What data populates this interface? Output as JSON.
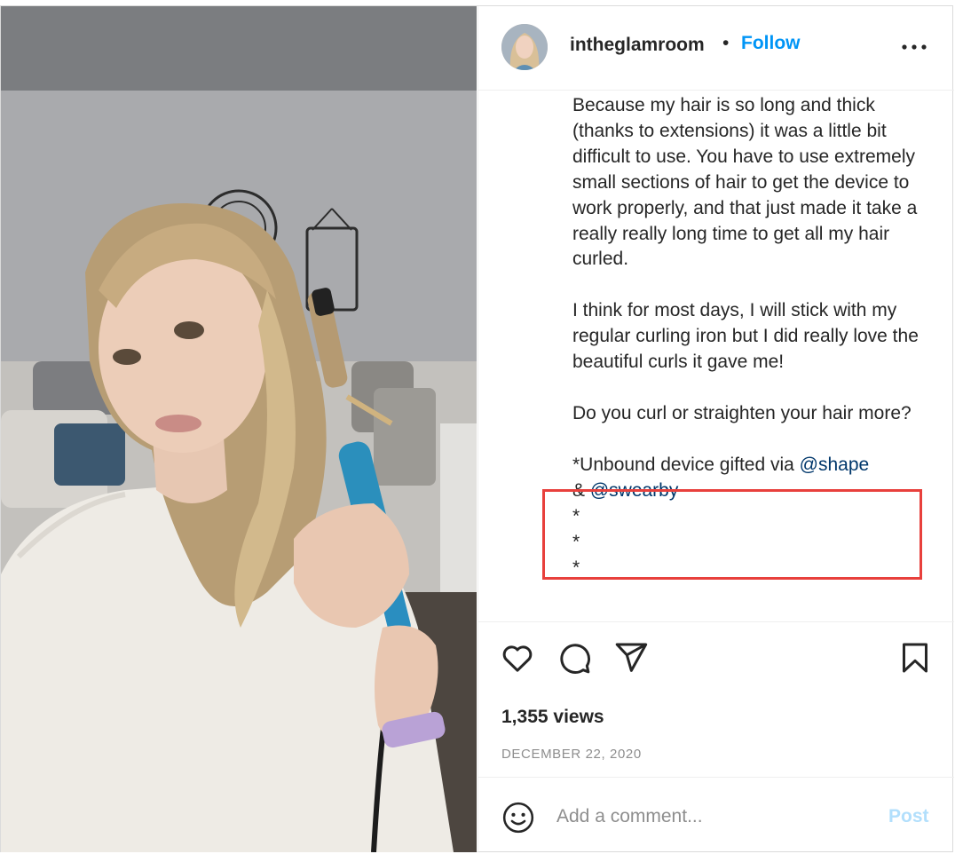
{
  "post": {
    "username": "intheglamroom",
    "separator": "•",
    "follow_label": "Follow",
    "more_icon": "more-horizontal-icon"
  },
  "caption": {
    "para1": "Because my hair is so long and thick (thanks to extensions) it was a little bit difficult to use. You have to use extremely small sections of hair to get the device to work properly, and that just made it take a really really long time to get all my hair curled.",
    "para2": "I think for most days, I will stick with my regular curling iron but I did really love the beautiful curls it gave me!",
    "para3": "Do you curl or straighten your hair more?",
    "gifted_prefix": "*Unbound device gifted via ",
    "mention1": "@shape",
    "ampersand": "& ",
    "mention2": "@swearby",
    "asterisk1": "*",
    "asterisk2": "*",
    "asterisk3": "*"
  },
  "actions": {
    "like_icon": "heart-icon",
    "comment_icon": "comment-icon",
    "share_icon": "send-icon",
    "save_icon": "bookmark-icon"
  },
  "stats": {
    "views": "1,355 views",
    "date": "DECEMBER 22, 2020"
  },
  "comment": {
    "emoji_icon": "emoji-icon",
    "placeholder": "Add a comment...",
    "post_label": "Post"
  },
  "colors": {
    "follow": "#0095f6",
    "mention": "#00376b",
    "highlight_box": "#e8403c",
    "post_disabled": "#b2dffc",
    "secondary_text": "#8e8e8e"
  }
}
